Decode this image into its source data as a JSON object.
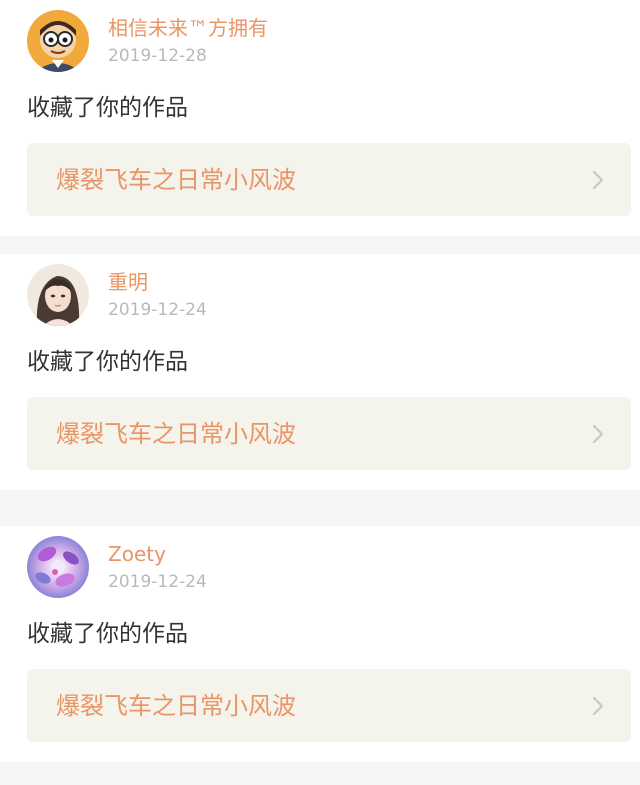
{
  "notifications": [
    {
      "user_name": "相信未来™方拥有",
      "date": "2019-12-28",
      "action": "收藏了你的作品",
      "work_title": "爆裂飞车之日常小风波",
      "avatar_icon": "cartoon-avatar-icon"
    },
    {
      "user_name": "重明",
      "date": "2019-12-24",
      "action": "收藏了你的作品",
      "work_title": "爆裂飞车之日常小风波",
      "avatar_icon": "portrait-avatar-icon"
    },
    {
      "user_name": "Zoety",
      "date": "2019-12-24",
      "action": "收藏了你的作品",
      "work_title": "爆裂飞车之日常小风波",
      "avatar_icon": "floral-avatar-icon"
    }
  ],
  "colors": {
    "accent": "#e99566",
    "date_gray": "#b9b9b9",
    "card_bg": "#ffffff",
    "link_bg": "#f4f3ec",
    "page_bg": "#f7f6f4",
    "chevron": "#c8c8c8"
  }
}
